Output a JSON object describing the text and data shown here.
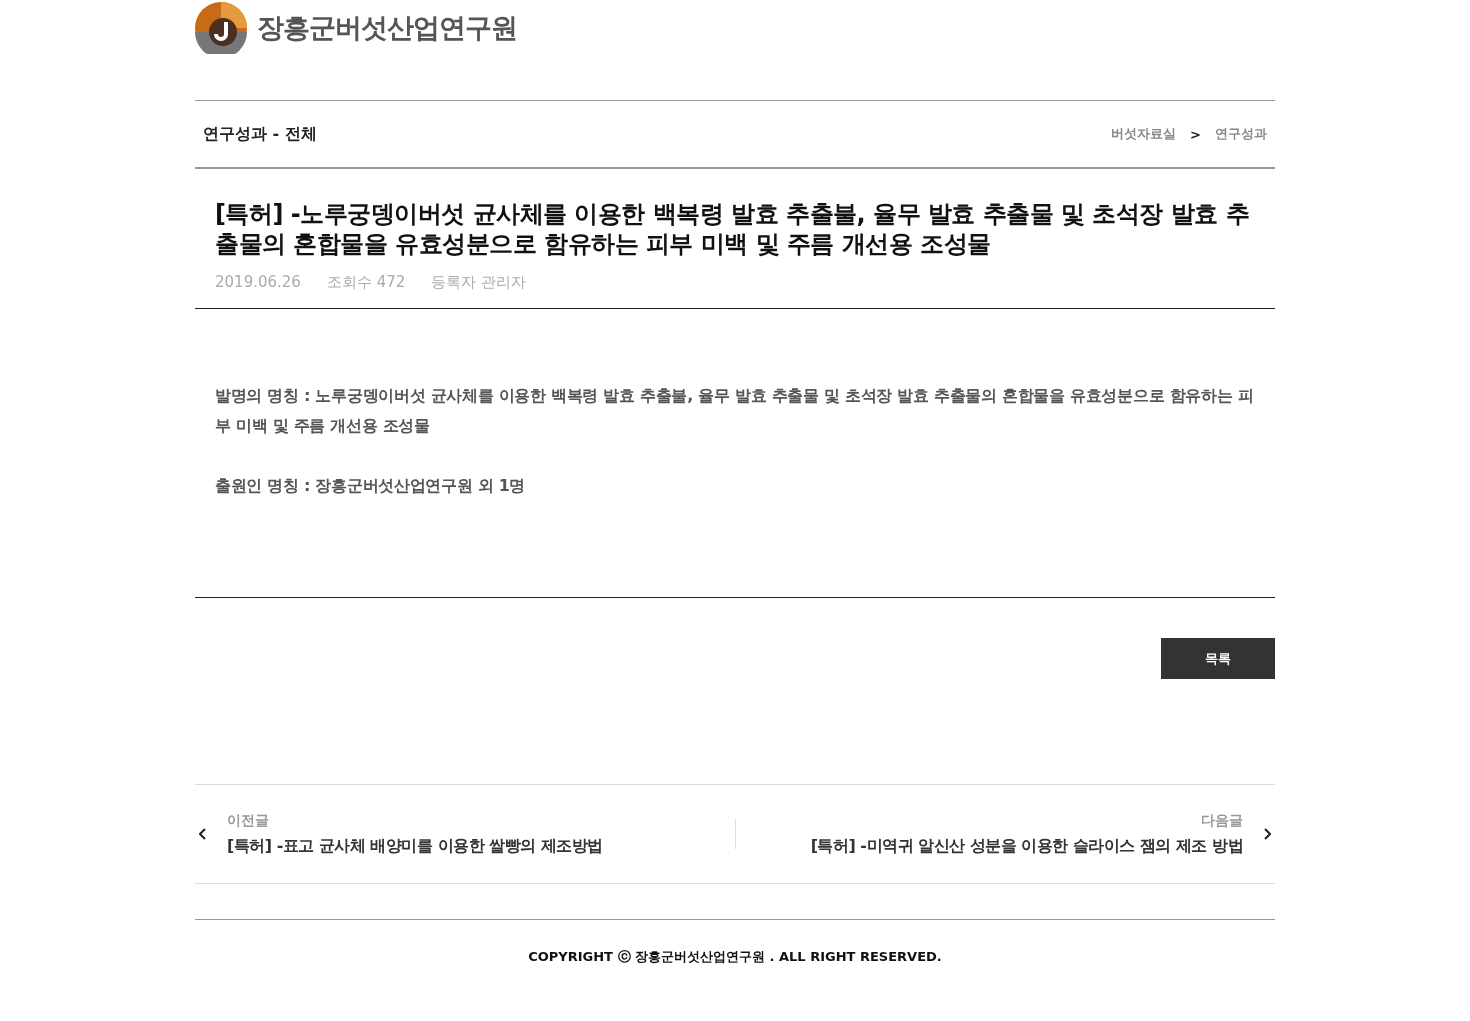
{
  "logo": {
    "name": "장흥군버섯산업연구원"
  },
  "section": {
    "title": "연구성과 - 전체",
    "breadcrumb": [
      "버섯자료실",
      "연구성과"
    ],
    "separator": ">"
  },
  "post": {
    "title": "[특허] -노루궁뎅이버섯 균사체를 이용한 백복령 발효 추출불, 율무 발효 추출물 및 초석장 발효 추출물의 혼합물을 유효성분으로 함유하는 피부 미백 및 주름 개선용 조성물",
    "date": "2019.06.26",
    "views": "조회수 472",
    "author": "등록자 관리자",
    "body": [
      "발명의 명칭 : 노루궁뎅이버섯 균사체를 이용한 백복령 발효 추출불, 율무 발효 추출물 및 초석장 발효 추출물의 혼합물을 유효성분으로 함유하는 피부 미백 및 주름 개선용 조성물",
      "출원인 명칭 : 장흥군버섯산업연구원 외 1명"
    ]
  },
  "list_button": "목록",
  "nav": [
    {
      "kind": "prev",
      "label": "이전글",
      "title": "[특허] -표고 균사체 배양미를 이용한 쌀빵의 제조방법"
    },
    {
      "kind": "next",
      "label": "다음글",
      "title": "[특허] -미역귀 알신산 성분을 이용한 슬라이스 잼의 제조 방법"
    }
  ],
  "footer": "COPYRIGHT ⓒ 장흥군버섯산업연구원 . ALL RIGHT RESERVED."
}
